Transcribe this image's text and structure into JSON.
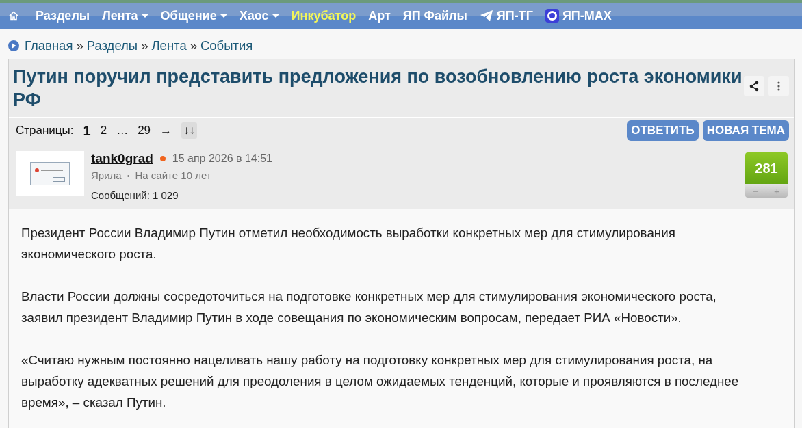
{
  "nav": {
    "items": [
      {
        "label": "Разделы",
        "dropdown": false,
        "highlight": false,
        "kind": "text"
      },
      {
        "label": "Лента",
        "dropdown": true,
        "highlight": false,
        "kind": "text"
      },
      {
        "label": "Общение",
        "dropdown": true,
        "highlight": false,
        "kind": "text"
      },
      {
        "label": "Хаос",
        "dropdown": true,
        "highlight": false,
        "kind": "text"
      },
      {
        "label": "Инкубатор",
        "dropdown": false,
        "highlight": true,
        "kind": "text"
      },
      {
        "label": "Арт",
        "dropdown": false,
        "highlight": false,
        "kind": "text"
      },
      {
        "label": "ЯП Файлы",
        "dropdown": false,
        "highlight": false,
        "kind": "text"
      },
      {
        "label": "ЯП-ТГ",
        "dropdown": false,
        "highlight": false,
        "kind": "telegram"
      },
      {
        "label": "ЯП-MAX",
        "dropdown": false,
        "highlight": false,
        "kind": "max"
      }
    ]
  },
  "breadcrumbs": {
    "separator": "»",
    "items": [
      "Главная",
      "Разделы",
      "Лента",
      "События"
    ]
  },
  "topic": {
    "title": "Путин поручил представить предложения по возобновлению роста экономики РФ"
  },
  "pagination": {
    "label": "Страницы:",
    "pages": [
      {
        "label": "1",
        "selected": true
      },
      {
        "label": "2",
        "selected": false
      },
      {
        "label": "…",
        "selected": false
      },
      {
        "label": "29",
        "selected": false
      }
    ],
    "next": "→",
    "jump": "↓↓"
  },
  "buttons": [
    "ОТВЕТИТЬ",
    "НОВАЯ ТЕМА"
  ],
  "post": {
    "author": "tank0grad",
    "online": true,
    "date": "15 апр 2026 в 14:51",
    "rank": "Ярила",
    "bullet": "•",
    "tenure": "На сайте 10 лет",
    "messages": "Сообщений: 1 029",
    "rating": {
      "value": "281",
      "minus": "−",
      "plus": "+"
    },
    "paragraphs": [
      "Президент России Владимир Путин отметил необходимость выработки конкретных мер для стимулирования экономического роста.",
      "Власти России должны сосредоточиться на подготовке конкретных мер для стимулирования экономического роста, заявил президент Владимир Путин в ходе совещания по экономическим вопросам, передает РИА «Новости».",
      "«Считаю нужным постоянно нацеливать нашу работу на подготовку конкретных мер для стимулирования роста, на выработку адекватных решений для преодоления в целом ожидаемых тенденций, которые и проявляются в последнее время», – сказал Путин."
    ]
  }
}
